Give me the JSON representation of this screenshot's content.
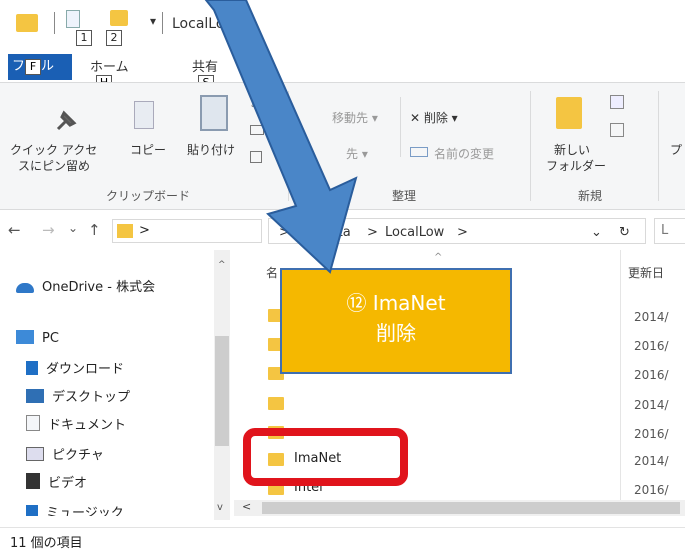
{
  "window": {
    "title": "LocalLow",
    "quick_access_badges": [
      "1",
      "2"
    ],
    "dropdown_caret": "▾"
  },
  "ribbon_tabs": {
    "file": "ファイル",
    "file_key": "F",
    "home": "ホーム",
    "home_key": "H",
    "share": "共有",
    "share_key": "S"
  },
  "ribbon": {
    "clipboard": {
      "pin_label_1": "クイック アクセ",
      "pin_label_2": "スにピン留め",
      "copy": "コピー",
      "paste": "貼り付け",
      "group": "クリップボード"
    },
    "organize": {
      "move_to": "移動先 ▾",
      "copy_to": "先 ▾",
      "delete": "✕ 削除 ▾",
      "rename": "名前の変更",
      "group": "整理"
    },
    "new": {
      "new_folder_1": "新しい",
      "new_folder_2": "フォルダー",
      "group": "新規"
    }
  },
  "address": {
    "back": "←",
    "forward": "→",
    "recent": "⌄",
    "up": "↑",
    "seg0": ">",
    "seg1": "appdata",
    "seg2": "LocalLow",
    "chev": ">",
    "dropdown": "⌄",
    "refresh": "↻",
    "search_placeholder": "L"
  },
  "nav_pane": {
    "items": [
      "OneDrive - 株式会",
      "PC",
      "ダウンロード",
      "デスクトップ",
      "ドキュメント",
      "ピクチャ",
      "ビデオ",
      "ミュージック"
    ]
  },
  "file_list": {
    "col_name": "名",
    "col_modified": "更新日",
    "rows": [
      {
        "name": "",
        "date": "2014/"
      },
      {
        "name": "",
        "date": "2016/"
      },
      {
        "name": "",
        "date": "2016/"
      },
      {
        "name": "",
        "date": "2014/"
      },
      {
        "name": "",
        "date": "2016/"
      },
      {
        "name": "ImaNet",
        "date": "2014/"
      },
      {
        "name": "Intel",
        "date": "2016/"
      }
    ]
  },
  "status_bar": {
    "count": "11 個の項目"
  },
  "callout": {
    "line1": "⑫ ImaNet",
    "line2": "削除"
  },
  "colors": {
    "accent": "#1a5fb4",
    "folder": "#f4c542",
    "callout": "#f5b800",
    "highlight": "#e0141c",
    "arrow": "#4a86c8"
  }
}
